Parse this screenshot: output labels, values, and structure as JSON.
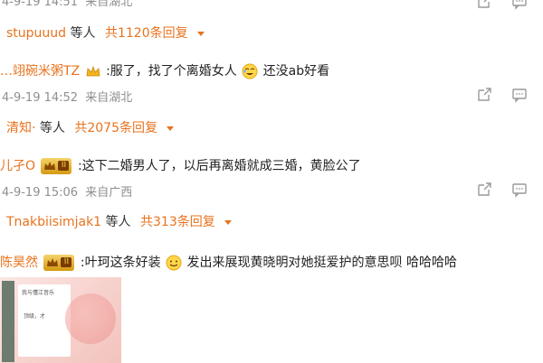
{
  "colors": {
    "accent": "#e8731e",
    "meta": "#8f8f8f"
  },
  "top_meta": {
    "datetime": "4-9-19 14:51",
    "location": "来自湖北"
  },
  "threads": [
    {
      "reply": {
        "names": "stupuuud",
        "sep": "等人",
        "count": "共1120条回复"
      }
    },
    {
      "user": "…翊碗米粥TZ",
      "text_before": ":服了，找了个离婚女人",
      "text_after": "还没ab好看",
      "datetime": "4-9-19 14:52",
      "location": "来自湖北",
      "reply": {
        "names": "清知·",
        "sep": "等人",
        "count": "共2075条回复"
      }
    },
    {
      "user": "儿孑O",
      "badge_level": "II",
      "text": ":这下二婚男人了，以后再离婚就成三婚，黄脸公了",
      "datetime": "4-9-19 15:06",
      "location": "来自广西",
      "reply": {
        "names": "Tnakbiisimjak1",
        "sep": "等人",
        "count": "共313条回复"
      }
    },
    {
      "user": "陈昊然",
      "badge_level": "II",
      "text_before": ":叶珂这条好装",
      "text_after": "发出来展现黄晓明对她挺爱护的意思呗 哈哈哈哈"
    }
  ],
  "icons": [
    "share-icon",
    "comment-icon",
    "crown-icon",
    "laugh-cry-emoji",
    "smile-emoji"
  ],
  "thumbnail": {
    "line1": "我与懂江音乐",
    "line2": "顶级，才"
  }
}
